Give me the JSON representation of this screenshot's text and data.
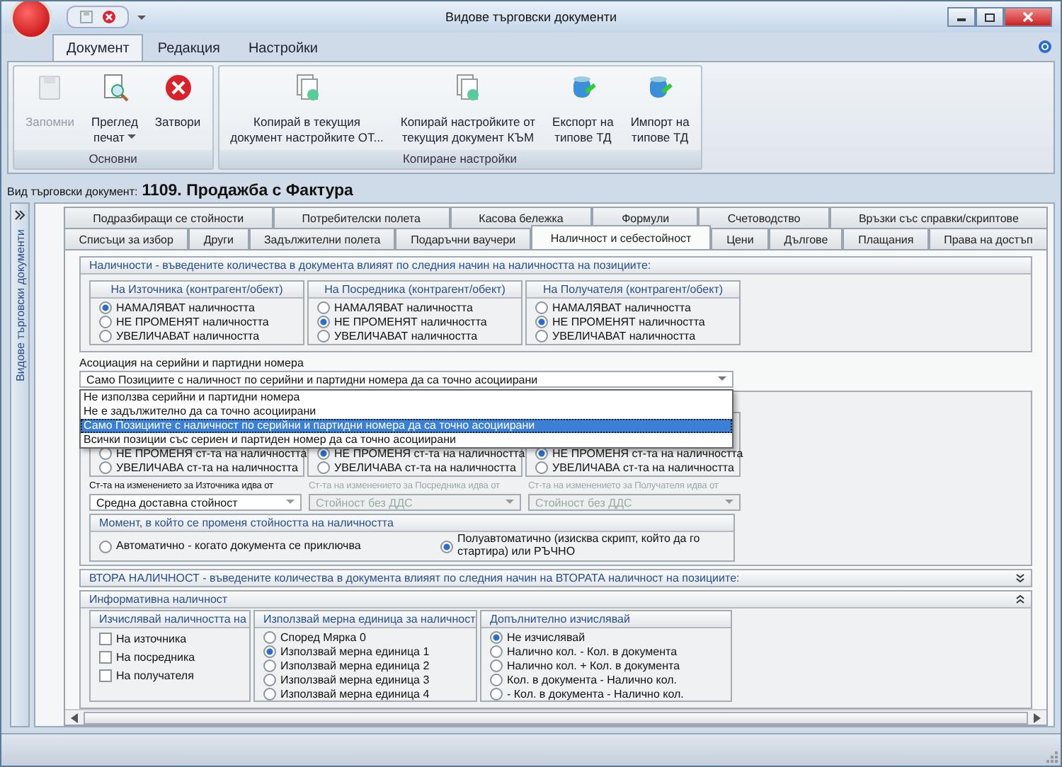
{
  "window": {
    "title": "Видове търговски документи"
  },
  "ribbon": {
    "tabs": [
      {
        "label": "Документ",
        "selected": true
      },
      {
        "label": "Редакция",
        "selected": false
      },
      {
        "label": "Настройки",
        "selected": false
      }
    ],
    "groups": [
      {
        "label": "Основни",
        "buttons": [
          {
            "kind": "save",
            "lines": [
              "Запомни"
            ],
            "disabled": true,
            "dropdown": false
          },
          {
            "kind": "preview",
            "lines": [
              "Преглед",
              "печат"
            ],
            "disabled": false,
            "dropdown": true
          },
          {
            "kind": "close",
            "lines": [
              "Затвори"
            ],
            "disabled": false,
            "dropdown": false
          }
        ]
      },
      {
        "label": "Копиране настройки",
        "buttons": [
          {
            "kind": "copy-in",
            "lines": [
              "Копирай в текущия",
              "документ настройките ОТ..."
            ],
            "disabled": false,
            "dropdown": false
          },
          {
            "kind": "copy-out",
            "lines": [
              "Копирай настройките от",
              "текущия документ КЪМ"
            ],
            "disabled": false,
            "dropdown": false
          },
          {
            "kind": "export",
            "lines": [
              "Експорт на",
              "типове ТД"
            ],
            "disabled": false,
            "dropdown": false
          },
          {
            "kind": "import",
            "lines": [
              "Импорт на",
              "типове ТД"
            ],
            "disabled": false,
            "dropdown": false
          }
        ]
      }
    ]
  },
  "doc_type": {
    "label": "Вид търговски документ:",
    "value": "1109. Продажба с Фактура"
  },
  "sidebar": {
    "label": "Видове търговски документи"
  },
  "tab_rows": [
    [
      {
        "label": "Подразбиращи се стойности",
        "selected": false
      },
      {
        "label": "Потребителски полета",
        "selected": false
      },
      {
        "label": "Касова бележка",
        "selected": false
      },
      {
        "label": "Формули",
        "selected": false
      },
      {
        "label": "Счетоводство",
        "selected": false
      },
      {
        "label": "Връзки със справки/скриптове",
        "selected": false
      }
    ],
    [
      {
        "label": "Списъци за избор",
        "selected": false
      },
      {
        "label": "Други",
        "selected": false
      },
      {
        "label": "Задължителни полета",
        "selected": false
      },
      {
        "label": "Подаръчни ваучери",
        "selected": false
      },
      {
        "label": "Наличност и себестойност",
        "selected": true
      },
      {
        "label": "Цени",
        "selected": false
      },
      {
        "label": "Дългове",
        "selected": false
      },
      {
        "label": "Плащания",
        "selected": false
      },
      {
        "label": "Права на достъп",
        "selected": false
      }
    ]
  ],
  "stock_section": {
    "title": "Наличности - въведените количества в документа влияят по следния начин на наличността на позициите:",
    "groups": [
      {
        "title": "На Източника (контрагент/обект)",
        "options": [
          {
            "label": "НАМАЛЯВАТ наличността",
            "selected": true
          },
          {
            "label": "НЕ ПРОМЕНЯТ наличността",
            "selected": false
          },
          {
            "label": "УВЕЛИЧАВАТ наличността",
            "selected": false
          }
        ]
      },
      {
        "title": "На Посредника (контрагент/обект)",
        "options": [
          {
            "label": "НАМАЛЯВАТ наличността",
            "selected": false
          },
          {
            "label": "НЕ ПРОМЕНЯТ наличността",
            "selected": true
          },
          {
            "label": "УВЕЛИЧАВАТ наличността",
            "selected": false
          }
        ]
      },
      {
        "title": "На Получателя (контрагент/обект)",
        "options": [
          {
            "label": "НАМАЛЯВАТ наличността",
            "selected": false
          },
          {
            "label": "НЕ ПРОМЕНЯТ наличността",
            "selected": true
          },
          {
            "label": "УВЕЛИЧАВАТ наличността",
            "selected": false
          }
        ]
      }
    ]
  },
  "association": {
    "label": "Асоциация на серийни и партидни номера",
    "value": "Само Позициите с наличност по серийни и партидни номера да са точно асоциирани",
    "open": true,
    "options": [
      {
        "label": "Не използва серийни и партидни номера",
        "selected": false
      },
      {
        "label": "Не е задължително да са точно асоциирани",
        "selected": false
      },
      {
        "label": "Само Позициите с наличност по серийни и партидни номера да са точно асоциирани",
        "selected": true
      },
      {
        "label": "Всички позиции със сериен и партиден номер да са точно асоциирани",
        "selected": false
      }
    ]
  },
  "value_section": {
    "groups": [
      {
        "options": [
          {
            "label": "НЕ ПРОМЕНЯ ст-та на наличността",
            "selected": false
          },
          {
            "label": "УВЕЛИЧАВА ст-та на наличността",
            "selected": false
          }
        ]
      },
      {
        "options": [
          {
            "label": "НЕ ПРОМЕНЯ ст-та на наличността",
            "selected": true
          },
          {
            "label": "УВЕЛИЧАВА ст-та на наличността",
            "selected": false
          }
        ]
      },
      {
        "options": [
          {
            "label": "НЕ ПРОМЕНЯ ст-та на наличността",
            "selected": true
          },
          {
            "label": "УВЕЛИЧАВА ст-та на наличността",
            "selected": false
          }
        ]
      }
    ],
    "sources": [
      {
        "label": "Ст-та на изменението за Източника идва от",
        "value": "Средна доставна стойност",
        "disabled": false
      },
      {
        "label": "Ст-та на изменението за Посредника идва от",
        "value": "Стойност без ДДС",
        "disabled": true
      },
      {
        "label": "Ст-та на изменението за Получателя идва от",
        "value": "Стойност без ДДС",
        "disabled": true
      }
    ],
    "moment": {
      "title": "Момент, в който се променя стойността на наличността",
      "options": [
        {
          "label": "Автоматично - когато документа се приключва",
          "selected": false
        },
        {
          "label": "Полуавтоматично (изисква скрипт, който да го стартира) или РЪЧНО",
          "selected": true
        }
      ]
    }
  },
  "second_stock": {
    "title": "ВТОРА НАЛИЧНОСТ - въведените количества в документа влияят по следния начин на ВТОРАТА наличност на позициите:",
    "expanded": false
  },
  "info_stock": {
    "title": "Информативна наличност",
    "expanded": true,
    "calc_on": {
      "title": "Изчислявай наличността на",
      "items": [
        {
          "label": "На източника",
          "checked": false
        },
        {
          "label": "На посредника",
          "checked": false
        },
        {
          "label": "На получателя",
          "checked": false
        }
      ]
    },
    "unit": {
      "title": "Използвай мерна единица за наличност",
      "options": [
        {
          "label": "Според Мярка 0",
          "selected": false
        },
        {
          "label": "Използвай мерна единица 1",
          "selected": true
        },
        {
          "label": "Използвай мерна единица 2",
          "selected": false
        },
        {
          "label": "Използвай мерна единица 3",
          "selected": false
        },
        {
          "label": "Използвай мерна единица 4",
          "selected": false
        }
      ]
    },
    "extra": {
      "title": "Допълнително изчислявай",
      "options": [
        {
          "label": "Не изчислявай",
          "selected": true
        },
        {
          "label": "Налично кол. - Кол. в документа",
          "selected": false
        },
        {
          "label": "Налично кол. + Кол. в документа",
          "selected": false
        },
        {
          "label": "Кол. в документа - Налично кол.",
          "selected": false
        },
        {
          "label": "- Кол. в документа - Налично кол.",
          "selected": false
        }
      ]
    }
  }
}
